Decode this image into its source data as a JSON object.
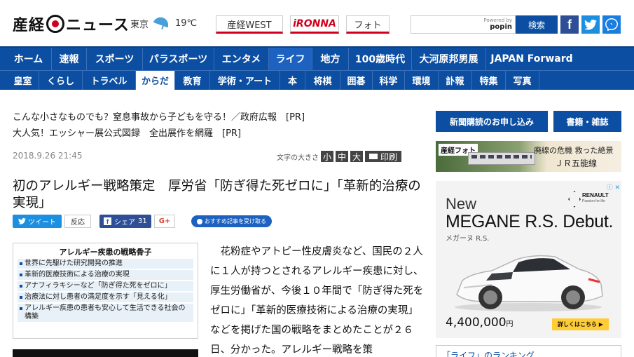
{
  "header": {
    "logo_left": "産経",
    "logo_right": "ニュース",
    "city": "東京",
    "temperature": "19℃",
    "tabs": [
      {
        "label": "産経WEST"
      },
      {
        "label": "iRONNA"
      },
      {
        "label": "フォト"
      }
    ],
    "search": {
      "powered_by": "Powered by",
      "powered_brand": "popin",
      "button": "検索"
    },
    "social": {
      "facebook": "f",
      "twitter": "t",
      "messenger": "m"
    }
  },
  "nav_primary": [
    {
      "label": "ホーム"
    },
    {
      "label": "速報"
    },
    {
      "label": "スポーツ"
    },
    {
      "label": "パラスポーツ"
    },
    {
      "label": "エンタメ"
    },
    {
      "label": "ライフ"
    },
    {
      "label": "地方"
    },
    {
      "label": "100歳時代"
    },
    {
      "label": "大河原邦男展"
    },
    {
      "label": "JAPAN Forward"
    }
  ],
  "nav_secondary": [
    {
      "label": "皇室"
    },
    {
      "label": "くらし"
    },
    {
      "label": "トラベル"
    },
    {
      "label": "からだ"
    },
    {
      "label": "教育"
    },
    {
      "label": "学術・アート"
    },
    {
      "label": "本"
    },
    {
      "label": "将棋"
    },
    {
      "label": "囲碁"
    },
    {
      "label": "科学"
    },
    {
      "label": "環境"
    },
    {
      "label": "訃報"
    },
    {
      "label": "特集"
    },
    {
      "label": "写真"
    }
  ],
  "pr_links": [
    "こんな小さなものでも？窒息事故から子どもを守る！／政府広報　[PR]",
    "大人気！エッシャー展公式図録　全出展作を網羅　[PR]"
  ],
  "article": {
    "date": "2018.9.26 21:45",
    "font_size_label": "文字の大きさ",
    "font_sizes": [
      "小",
      "中",
      "大"
    ],
    "print_label": "印刷",
    "headline": "初のアレルギー戦略策定　厚労省「防ぎ得た死ゼロに」「革新的治療の実現」",
    "share": {
      "tweet": "ツイート",
      "reaction": "反応",
      "facebook_share": "シェア",
      "facebook_count": "31",
      "gplus": "G+",
      "recommend": "おすすめ記事を受け取る"
    },
    "infobox": {
      "title": "アレルギー疾患の戦略骨子",
      "bullets": [
        "世界に先駆けた研究開発の推進",
        "革新的医療技術による治療の実現",
        "アナフィラキシーなど「防ぎ得た死をゼロに」",
        "治療法に対し患者の満足度を示す「見える化」",
        "アレルギー疾患の患者も安心して生活できる社会の構築"
      ]
    },
    "body": "花粉症やアトピー性皮膚炎など、国民の２人に１人が持つとされるアレルギー疾患に対し、厚生労働省が、今後１０年間で「防ぎ得た死をゼロに」「革新的医療技術による治療の実現」などを掲げた国の戦略をまとめたことが２６日、分かった。アレルギー戦略を策"
  },
  "sidebar": {
    "subscribe": "新聞購読のお申し込み",
    "books": "書籍・雑誌",
    "photo_banner": {
      "brand": "産経フォト",
      "caption1": "廃線の危機 救った絶景",
      "caption2": "ＪＲ五能線"
    },
    "ad": {
      "adchoices": "ⓘ ✕",
      "brand": "RENAULT",
      "brand_tagline": "Passion for life",
      "new": "New",
      "model": "MEGANE R.S. Debut.",
      "kana": "メガーヌ R.S.",
      "price": "4,400,000",
      "price_unit": "円",
      "cta": "詳しくはこちら ▶"
    },
    "ranking_title": "「ライフ」のランキング"
  }
}
